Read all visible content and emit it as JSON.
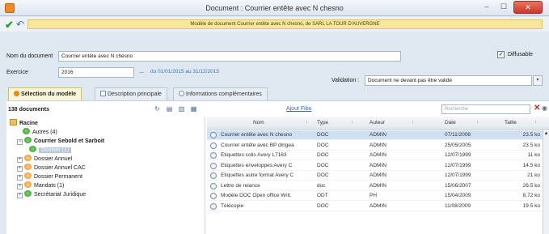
{
  "window": {
    "title": "Document : Courrier entête avec N chesno",
    "min": "–",
    "max": "☐",
    "close": "✕"
  },
  "toolbar": {
    "banner": "Modèle de document Courrier entête avec N chesno, de SARL LA TOUR D'AUVERGNE"
  },
  "form": {
    "doc_name_label": "Nom du document",
    "doc_name_value": "Courrier entête avec N chesno",
    "diffusable_label": "Diffusable",
    "diffusable_checked": "✓",
    "exercice_label": "Exercice",
    "exercice_value": "2016",
    "exercice_separator": "...",
    "exercice_range": "du 01/01/2015 au 31/12/2015",
    "validation_label": "Validation :",
    "validation_value": "Document ne devant pas être validé",
    "validation_arrow": "▾"
  },
  "tabs": [
    {
      "label": "Sélection du modèle"
    },
    {
      "label": "Description principale"
    },
    {
      "label": "Informations complémentaires"
    }
  ],
  "list_toolbar": {
    "count": "138 documents",
    "link": "Ajout Fibu",
    "search_placeholder": "Recherche",
    "clear": "✕",
    "eye": "◉"
  },
  "tree": {
    "root": "Racine",
    "items": [
      {
        "label": "Autres (4)",
        "exp": "",
        "color": "green"
      },
      {
        "label": "Courrier Sebold et Sarboit",
        "exp": "−",
        "color": "green"
      },
      {
        "label": "Dossier (1)",
        "exp": "",
        "color": "green",
        "selected": true
      },
      {
        "label": "Dossier Annuel",
        "exp": "+",
        "color": "orange"
      },
      {
        "label": "Dossier Annuel CAC",
        "exp": "+",
        "color": "orange"
      },
      {
        "label": "Dossier Permanent",
        "exp": "+",
        "color": "orange"
      },
      {
        "label": "Mandats (1)",
        "exp": "+",
        "color": "orange"
      },
      {
        "label": "Secrétariat Juridique",
        "exp": "+",
        "color": "green"
      }
    ]
  },
  "grid": {
    "columns": [
      "Nom",
      "Type",
      "Auteur",
      "Date",
      "Taille"
    ],
    "rows": [
      {
        "nom": "Courrier entête avec N chesno",
        "type": "DOC",
        "auteur": "ADMIN",
        "date": "07/11/2008",
        "taille": "23.5 ko",
        "selected": true
      },
      {
        "nom": "Courrier entête avec BP dirigea",
        "type": "DOC",
        "auteur": "ADMIN",
        "date": "25/05/2005",
        "taille": "23.5 ko"
      },
      {
        "nom": "Etiquettes colis Avery L7163",
        "type": "DOC",
        "auteur": "ADMIN",
        "date": "12/07/1999",
        "taille": "11 ko"
      },
      {
        "nom": "Etiquettes enveloppes Avery C",
        "type": "DOC",
        "auteur": "ADMIN",
        "date": "12/07/1999",
        "taille": "14.5 ko"
      },
      {
        "nom": "Etiquettes autre format Avery C",
        "type": "DOC",
        "auteur": "ADMIN",
        "date": "12/07/1999",
        "taille": "21 ko"
      },
      {
        "nom": "Lettre de relance",
        "type": "doc",
        "auteur": "ADMIN",
        "date": "15/06/2007",
        "taille": "26.5 ko"
      },
      {
        "nom": "Modèle DOC Open office Writ.",
        "type": "ODT",
        "auteur": "PH",
        "date": "15/04/2009",
        "taille": "8.72 ko"
      },
      {
        "nom": "Télécopie",
        "type": "DOC",
        "auteur": "ADMIN",
        "date": "11/08/2009",
        "taille": "19.5 ko"
      }
    ]
  },
  "colors": {
    "banner_bg": "#f6e79c",
    "close_red": "#c8392a",
    "accent_blue": "#3c78c4",
    "folder_green": "#2f9a2a",
    "folder_orange": "#e5891b"
  }
}
